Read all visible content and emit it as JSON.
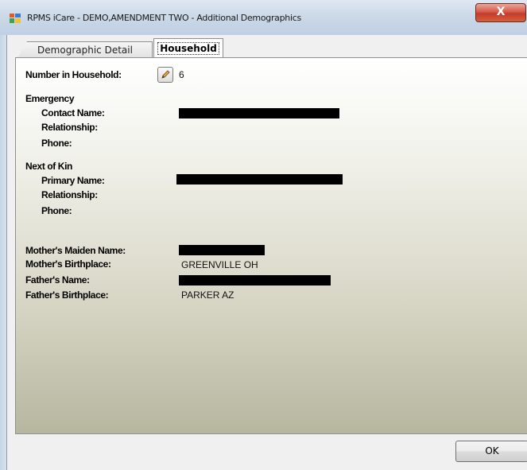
{
  "window": {
    "title": "RPMS iCare - DEMO,AMENDMENT TWO - Additional Demographics",
    "close_label": "X"
  },
  "tabs": [
    {
      "label": "Demographic Detail",
      "selected": false
    },
    {
      "label": "Household",
      "selected": true
    }
  ],
  "household": {
    "number_label": "Number in Household:",
    "number_value": "6",
    "emergency": {
      "heading": "Emergency",
      "contact_label": "Contact Name:",
      "relationship_label": "Relationship:",
      "phone_label": "Phone:"
    },
    "next_of_kin": {
      "heading": "Next of Kin",
      "primary_label": "Primary Name:",
      "relationship_label": "Relationship:",
      "phone_label": "Phone:"
    },
    "mother_maiden_label": "Mother's Maiden Name:",
    "mother_birthplace_label": "Mother's Birthplace:",
    "mother_birthplace_value": "GREENVILLE OH",
    "father_name_label": "Father's Name:",
    "father_birthplace_label": "Father's Birthplace:",
    "father_birthplace_value": "PARKER AZ"
  },
  "footer": {
    "ok_label": "OK"
  },
  "icons": {
    "app": "app-icon",
    "edit": "pencil-icon",
    "close": "close-icon"
  }
}
